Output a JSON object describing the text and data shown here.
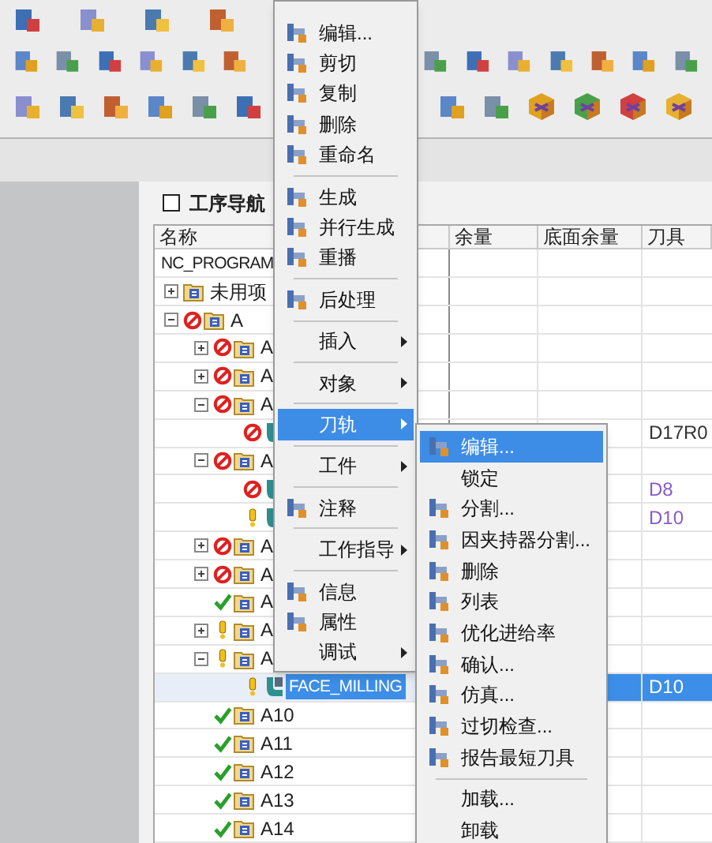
{
  "navigator": {
    "title": "工序导航",
    "columns": [
      "名称",
      "余量",
      "底面余量",
      "刀具"
    ],
    "rows": [
      {
        "kind": "program",
        "name": "NC_PROGRAM",
        "selected": false,
        "children": [
          {
            "kind": "group",
            "name": "未用项",
            "blocked": false,
            "warning": false,
            "complete": false,
            "expanded": false,
            "selected": false
          },
          {
            "kind": "group",
            "name": "A",
            "blocked": true,
            "warning": false,
            "complete": false,
            "expanded": true,
            "selected": false,
            "children": [
              {
                "kind": "group",
                "name": "A",
                "blocked": true,
                "warning": false,
                "complete": false,
                "expanded": false,
                "selected": false
              },
              {
                "kind": "group",
                "name": "A",
                "blocked": true,
                "warning": false,
                "complete": false,
                "expanded": false,
                "selected": false
              },
              {
                "kind": "group",
                "name": "A",
                "blocked": true,
                "warning": false,
                "complete": false,
                "expanded": true,
                "selected": false,
                "children": [
                  {
                    "kind": "operation",
                    "blocked": true,
                    "warning": false,
                    "complete": false,
                    "selected": false,
                    "tool": {
                      "text": "D17R0",
                      "color": "#333333"
                    }
                  }
                ]
              },
              {
                "kind": "group",
                "name": "A",
                "blocked": true,
                "warning": false,
                "complete": false,
                "expanded": true,
                "selected": false,
                "children": [
                  {
                    "kind": "operation",
                    "blocked": true,
                    "warning": false,
                    "complete": false,
                    "selected": false,
                    "tool": {
                      "text": "D8",
                      "color": "#8a5cc9"
                    }
                  },
                  {
                    "kind": "operation",
                    "blocked": false,
                    "warning": true,
                    "complete": false,
                    "selected": false,
                    "tool": {
                      "text": "D10",
                      "color": "#8a5cc9"
                    }
                  }
                ]
              },
              {
                "kind": "group",
                "name": "A",
                "blocked": true,
                "warning": false,
                "complete": false,
                "expanded": false,
                "selected": false
              },
              {
                "kind": "group",
                "name": "A",
                "blocked": true,
                "warning": false,
                "complete": false,
                "expanded": false,
                "selected": false
              },
              {
                "kind": "group",
                "name": "A",
                "blocked": false,
                "warning": false,
                "complete": true,
                "selected": false
              },
              {
                "kind": "group",
                "name": "A",
                "blocked": false,
                "warning": true,
                "complete": false,
                "expanded": false,
                "selected": false
              },
              {
                "kind": "group",
                "name": "A",
                "blocked": false,
                "warning": true,
                "complete": false,
                "expanded": true,
                "selected": false,
                "children": [
                  {
                    "kind": "operation",
                    "name": "FACE_MILLING",
                    "blocked": false,
                    "warning": true,
                    "complete": false,
                    "selected": true,
                    "tool": {
                      "text": "D10"
                    }
                  }
                ]
              },
              {
                "kind": "group",
                "name": "A10",
                "blocked": false,
                "warning": false,
                "complete": true,
                "selected": false
              },
              {
                "kind": "group",
                "name": "A11",
                "blocked": false,
                "warning": false,
                "complete": true,
                "selected": false
              },
              {
                "kind": "group",
                "name": "A12",
                "blocked": false,
                "warning": false,
                "complete": true,
                "selected": false
              },
              {
                "kind": "group",
                "name": "A13",
                "blocked": false,
                "warning": false,
                "complete": true,
                "selected": false
              },
              {
                "kind": "group",
                "name": "A14",
                "blocked": false,
                "warning": false,
                "complete": true,
                "selected": false
              }
            ]
          }
        ]
      }
    ]
  },
  "context_menu": {
    "items": [
      {
        "kind": "command",
        "label": "编辑...",
        "submenu": false,
        "selected": false
      },
      {
        "kind": "command",
        "label": "剪切",
        "submenu": false,
        "selected": false
      },
      {
        "kind": "command",
        "label": "复制",
        "submenu": false,
        "selected": false
      },
      {
        "kind": "command",
        "label": "删除",
        "submenu": false,
        "selected": false
      },
      {
        "kind": "command",
        "label": "重命名",
        "submenu": false,
        "selected": false
      },
      {
        "kind": "separator"
      },
      {
        "kind": "command",
        "label": "生成",
        "submenu": false,
        "selected": false
      },
      {
        "kind": "command",
        "label": "并行生成",
        "submenu": false,
        "selected": false
      },
      {
        "kind": "command",
        "label": "重播",
        "submenu": false,
        "selected": false
      },
      {
        "kind": "separator"
      },
      {
        "kind": "command",
        "label": "后处理",
        "submenu": false,
        "selected": false
      },
      {
        "kind": "separator"
      },
      {
        "kind": "text",
        "label": "插入",
        "submenu": true,
        "selected": false
      },
      {
        "kind": "separator"
      },
      {
        "kind": "text",
        "label": "对象",
        "submenu": true,
        "selected": false
      },
      {
        "kind": "separator"
      },
      {
        "kind": "text",
        "label": "刀轨",
        "submenu": true,
        "selected": true
      },
      {
        "kind": "separator"
      },
      {
        "kind": "text",
        "label": "工件",
        "submenu": true,
        "selected": false
      },
      {
        "kind": "separator"
      },
      {
        "kind": "command",
        "label": "注释",
        "submenu": false,
        "selected": false
      },
      {
        "kind": "separator"
      },
      {
        "kind": "text",
        "label": "工作指导",
        "submenu": true,
        "selected": false
      },
      {
        "kind": "separator"
      },
      {
        "kind": "command",
        "label": "信息",
        "submenu": false,
        "selected": false
      },
      {
        "kind": "command",
        "label": "属性",
        "submenu": false,
        "selected": false
      },
      {
        "kind": "text",
        "label": "调试",
        "submenu": true,
        "selected": false
      }
    ]
  },
  "submenu": {
    "items": [
      {
        "kind": "command",
        "label": "编辑...",
        "selected": true
      },
      {
        "kind": "text",
        "label": "锁定",
        "selected": false
      },
      {
        "kind": "command",
        "label": "分割...",
        "selected": false
      },
      {
        "kind": "command",
        "label": "因夹持器分割...",
        "selected": false
      },
      {
        "kind": "command",
        "label": "删除",
        "selected": false
      },
      {
        "kind": "command",
        "label": "列表",
        "selected": false
      },
      {
        "kind": "command",
        "label": "优化进给率",
        "selected": false
      },
      {
        "kind": "command",
        "label": "确认...",
        "selected": false
      },
      {
        "kind": "command",
        "label": "仿真...",
        "selected": false
      },
      {
        "kind": "command",
        "label": "过切检查...",
        "selected": false
      },
      {
        "kind": "command",
        "label": "报告最短刀具",
        "selected": false
      },
      {
        "kind": "separator"
      },
      {
        "kind": "text",
        "label": "加载...",
        "selected": false
      },
      {
        "kind": "text",
        "label": "卸载",
        "selected": false
      }
    ]
  }
}
